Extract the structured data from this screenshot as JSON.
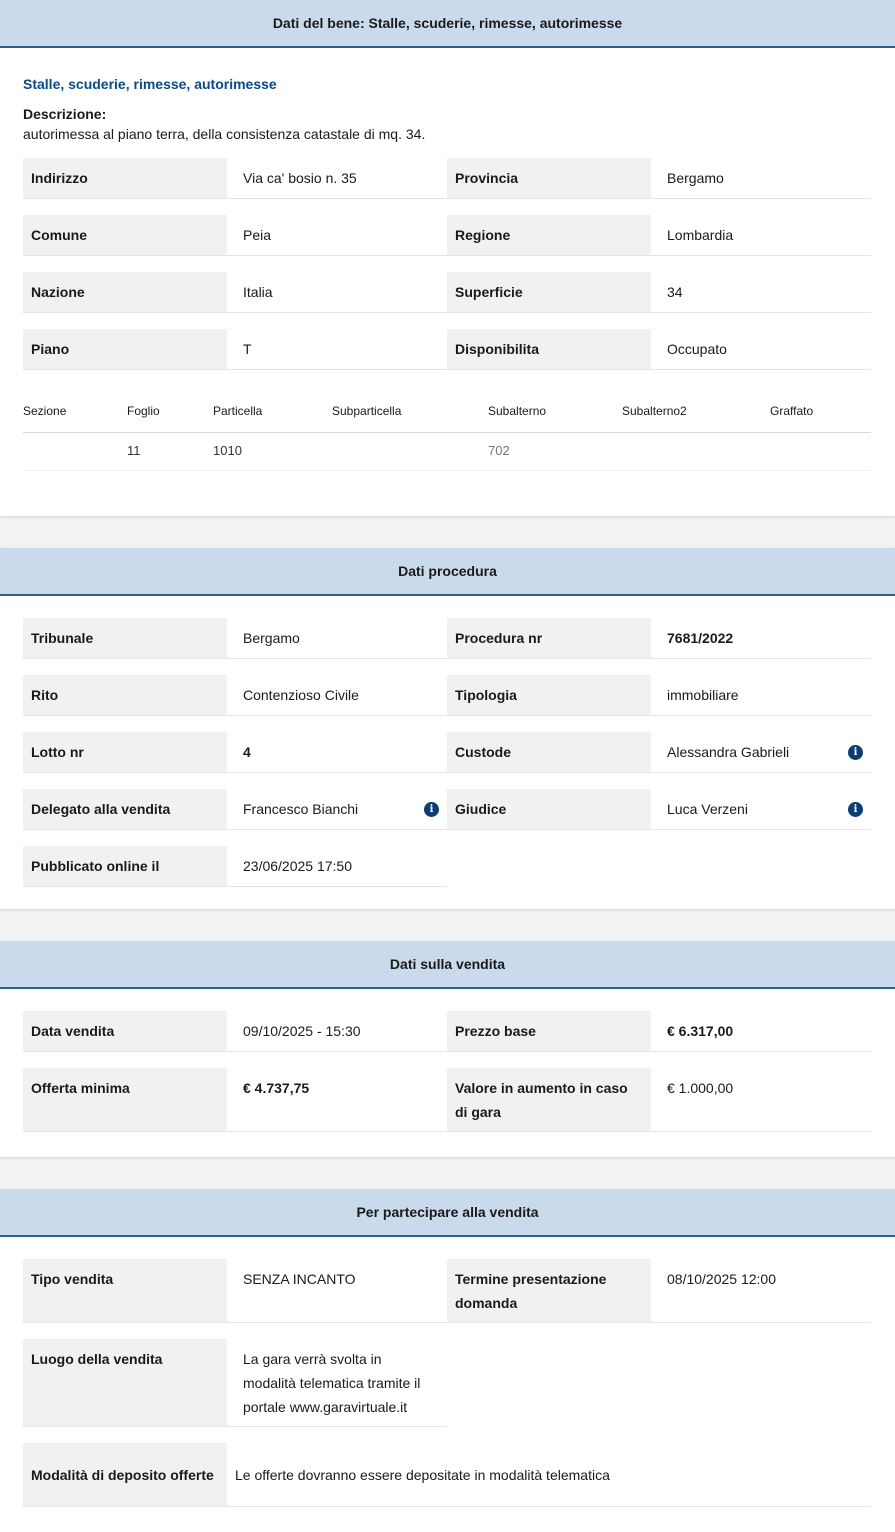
{
  "bene": {
    "header": "Dati del bene: Stalle, scuderie, rimesse, autorimesse",
    "subtitle": "Stalle, scuderie, rimesse, autorimesse",
    "description_label": "Descrizione:",
    "description": "autorimessa al piano terra, della consistenza catastale di mq. 34.",
    "rows": [
      {
        "l1": "Indirizzo",
        "v1": "Via ca' bosio n. 35",
        "l2": "Provincia",
        "v2": "Bergamo"
      },
      {
        "l1": "Comune",
        "v1": "Peia",
        "l2": "Regione",
        "v2": "Lombardia"
      },
      {
        "l1": "Nazione",
        "v1": "Italia",
        "l2": "Superficie",
        "v2": "34"
      },
      {
        "l1": "Piano",
        "v1": "T",
        "l2": "Disponibilita",
        "v2": "Occupato"
      }
    ],
    "catasto": {
      "headers": [
        "Sezione",
        "Foglio",
        "Particella",
        "Subparticella",
        "Subalterno",
        "Subalterno2",
        "Graffato"
      ],
      "row": [
        "",
        "11",
        "1010",
        "",
        "702",
        "",
        ""
      ]
    }
  },
  "procedura": {
    "header": "Dati procedura",
    "tribunale_label": "Tribunale",
    "tribunale": "Bergamo",
    "procedura_label": "Procedura nr",
    "procedura": "7681/2022",
    "rito_label": "Rito",
    "rito": "Contenzioso Civile",
    "tipologia_label": "Tipologia",
    "tipologia": "immobiliare",
    "lotto_label": "Lotto nr",
    "lotto": "4",
    "custode_label": "Custode",
    "custode": "Alessandra Gabrieli",
    "delegato_label": "Delegato alla vendita",
    "delegato": "Francesco Bianchi",
    "giudice_label": "Giudice",
    "giudice": "Luca Verzeni",
    "pubblicato_label": "Pubblicato online il",
    "pubblicato": "23/06/2025 17:50",
    "info_glyph": "i"
  },
  "vendita": {
    "header": "Dati sulla vendita",
    "data_label": "Data vendita",
    "data": "09/10/2025 - 15:30",
    "prezzo_label": "Prezzo base",
    "prezzo": "€ 6.317,00",
    "offerta_label": "Offerta minima",
    "offerta": "€ 4.737,75",
    "aumento_label": "Valore in aumento in caso di gara",
    "aumento": "€ 1.000,00"
  },
  "partecipare": {
    "header": "Per partecipare alla vendita",
    "tipo_label": "Tipo vendita",
    "tipo": "SENZA INCANTO",
    "termine_label": "Termine presentazione domanda",
    "termine": "08/10/2025 12:00",
    "luogo_label": "Luogo della vendita",
    "luogo": "La gara verrà svolta in modalità telematica tramite il portale www.garavirtuale.it",
    "modalita_label": "Modalità di deposito offerte",
    "modalita": "Le offerte dovranno essere depositate in modalità telematica"
  }
}
